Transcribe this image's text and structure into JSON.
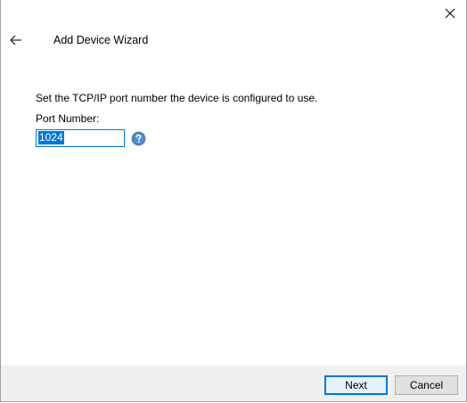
{
  "window": {
    "title": "Add Device Wizard"
  },
  "content": {
    "instruction": "Set the TCP/IP port number the device is configured to use.",
    "port_label": "Port Number:",
    "port_value": "1024"
  },
  "buttons": {
    "next": "Next",
    "cancel": "Cancel"
  },
  "icons": {
    "back": "back-arrow-icon",
    "close": "close-icon",
    "help": "help-icon"
  },
  "colors": {
    "accent": "#0078d7",
    "footer_bg": "#f0f0f0",
    "help_blue": "#3a78c2"
  }
}
